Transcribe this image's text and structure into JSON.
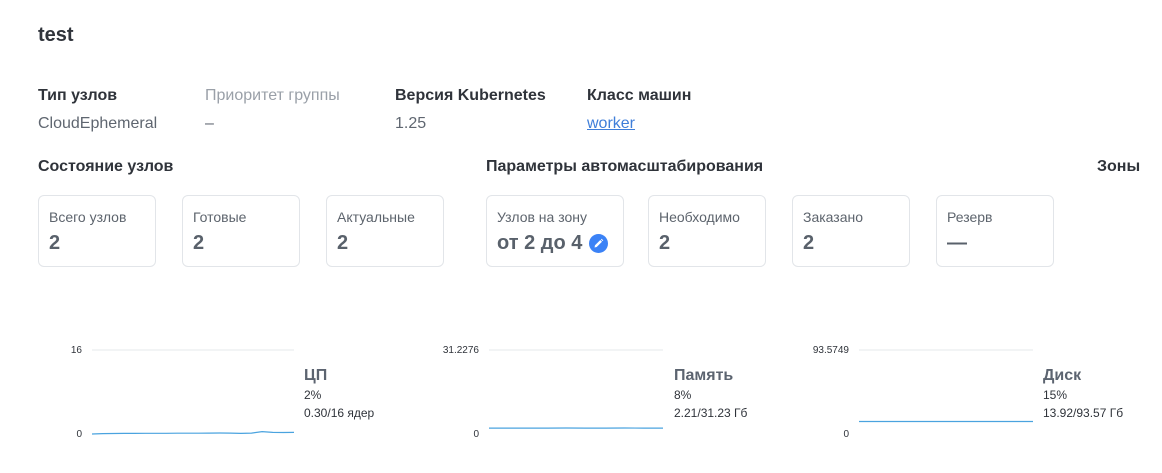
{
  "page": {
    "title": "test"
  },
  "info": {
    "node_type": {
      "label": "Тип узлов",
      "value": "CloudEphemeral"
    },
    "group_priority": {
      "label": "Приоритет группы",
      "value": "–"
    },
    "k8s_version": {
      "label": "Версия Kubernetes",
      "value": "1.25"
    },
    "machine_class": {
      "label": "Класс машин",
      "value": "worker"
    }
  },
  "sections": {
    "node_state": "Состояние узлов",
    "autoscaling": "Параметры автомасштабирования",
    "zones": "Зоны"
  },
  "node_state_cards": [
    {
      "label": "Всего узлов",
      "value": "2"
    },
    {
      "label": "Готовые",
      "value": "2"
    },
    {
      "label": "Актуальные",
      "value": "2"
    }
  ],
  "autoscaling_cards": [
    {
      "label": "Узлов на зону",
      "value": "от 2 до 4",
      "icon": "pencil-icon"
    },
    {
      "label": "Необходимо",
      "value": "2"
    },
    {
      "label": "Заказано",
      "value": "2"
    },
    {
      "label": "Резерв",
      "value": "—"
    }
  ],
  "colors": {
    "accent": "#3b82f6",
    "link": "#3f7ed9",
    "chart_line": "#4aa3df",
    "grid": "#e6e8eb"
  },
  "chart_data": [
    {
      "type": "line",
      "name": "ЦП",
      "percent": "2%",
      "detail": "0.30/16 ядер",
      "ylim": [
        0,
        16
      ],
      "y_ticks": [
        "16",
        "0"
      ],
      "values": [
        0.0,
        0.08,
        0.1,
        0.11,
        0.12,
        0.14,
        0.13,
        0.14,
        0.16,
        0.15,
        0.16,
        0.17,
        0.2,
        0.17,
        0.12,
        0.18,
        0.46,
        0.3,
        0.28,
        0.3
      ]
    },
    {
      "type": "line",
      "name": "Память",
      "percent": "8%",
      "detail": "2.21/31.23 Гб",
      "ylim": [
        0,
        31.2276
      ],
      "y_ticks": [
        "31.2276",
        "0"
      ],
      "values": [
        2.21,
        2.21,
        2.2,
        2.21,
        2.22,
        2.21,
        2.21,
        2.22,
        2.21,
        2.21
      ]
    },
    {
      "type": "line",
      "name": "Диск",
      "percent": "15%",
      "detail": "13.92/93.57 Гб",
      "ylim": [
        0,
        93.5749
      ],
      "y_ticks": [
        "93.5749",
        "0"
      ],
      "values": [
        13.92,
        13.92,
        13.92,
        13.92,
        13.92,
        13.92,
        13.92,
        13.92
      ]
    }
  ]
}
